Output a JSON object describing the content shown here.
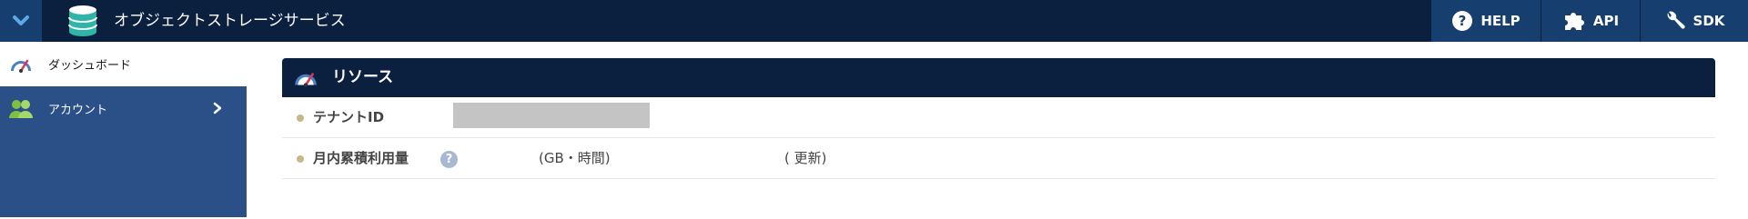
{
  "app": {
    "title": "オブジェクトストレージサービス"
  },
  "topnav": {
    "help": "HELP",
    "api": "API",
    "sdk": "SDK"
  },
  "sidebar": {
    "items": [
      {
        "label": "ダッシュボード",
        "icon": "speedometer-icon",
        "active": true
      },
      {
        "label": "アカウント",
        "icon": "users-icon",
        "active": false
      }
    ]
  },
  "panel": {
    "title": "リソース",
    "rows": [
      {
        "label": "テナントID",
        "value": ""
      },
      {
        "label": "月内累積利用量",
        "unit": "(GB・時間)",
        "update": "( 更新)"
      }
    ]
  },
  "colors": {
    "topbar": "#0b1f3f",
    "nav_button": "#163e6e",
    "sidebar": "#2b5087",
    "bullet": "#c8b78b"
  }
}
